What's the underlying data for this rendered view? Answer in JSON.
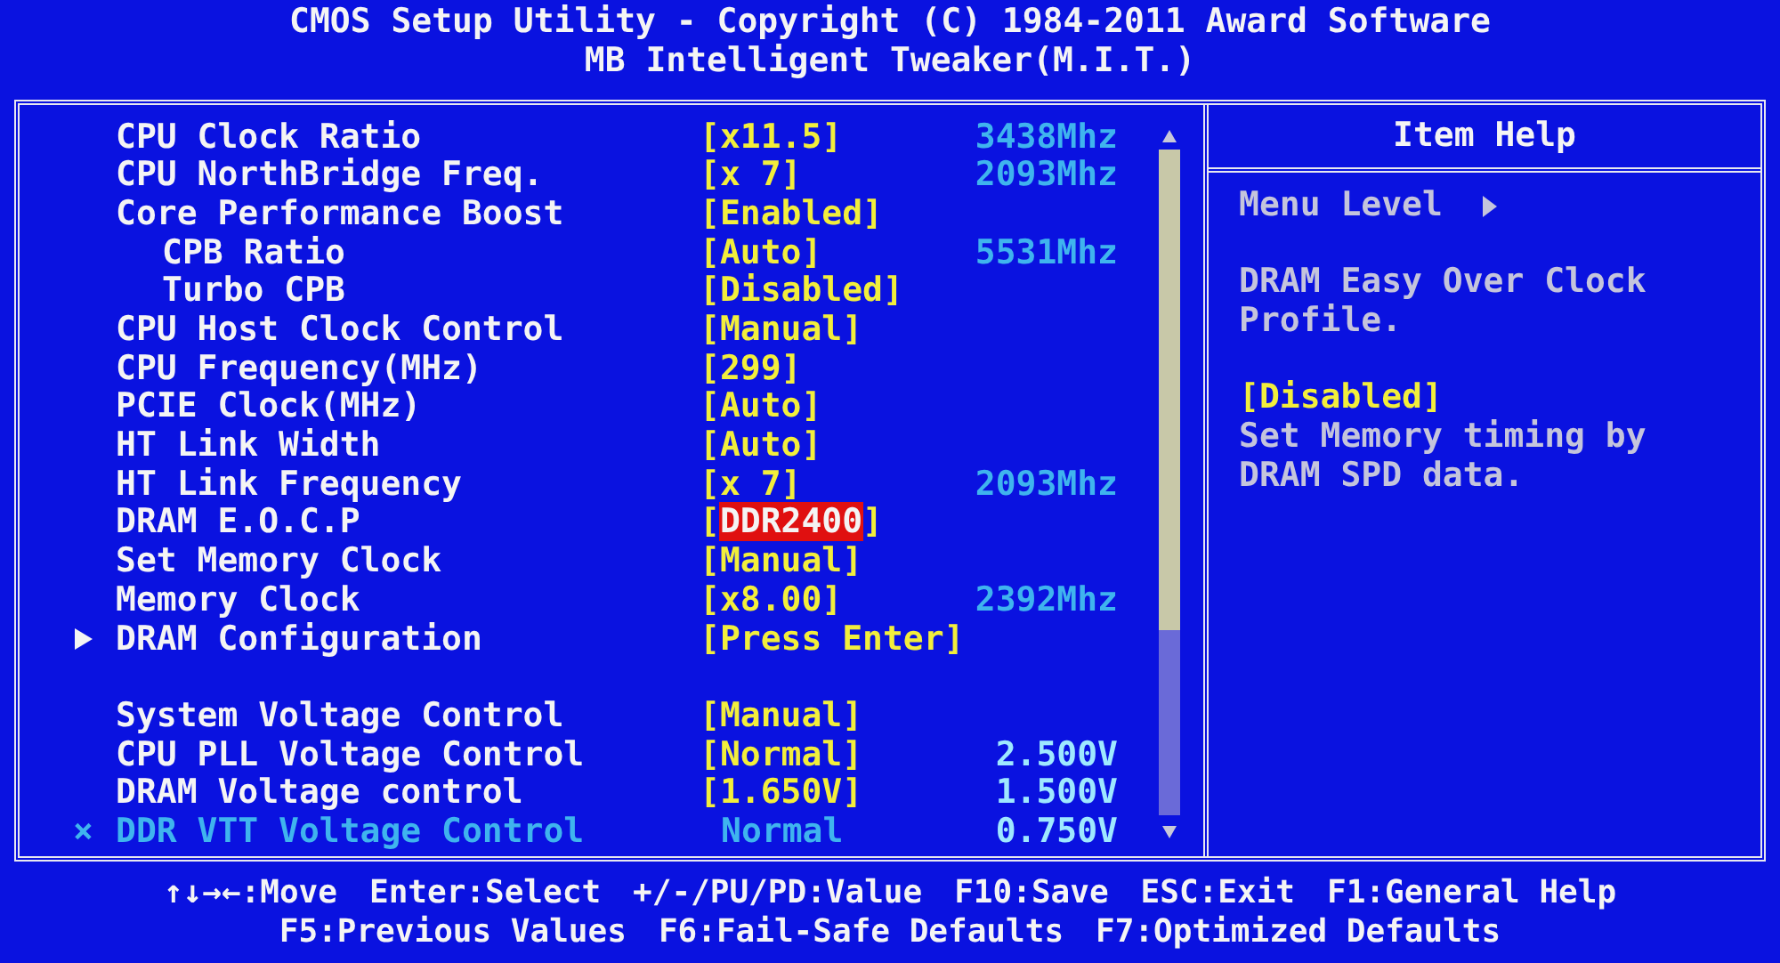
{
  "header": {
    "title": "CMOS Setup Utility - Copyright (C) 1984-2011 Award Software",
    "subtitle": "MB Intelligent Tweaker(M.I.T.)"
  },
  "settings": [
    {
      "kind": "setting",
      "label": "CPU Clock Ratio",
      "value": "[x11.5]",
      "reading": "3438Mhz",
      "selected": false,
      "disabled": false
    },
    {
      "kind": "setting",
      "label": "CPU NorthBridge Freq.",
      "value": "[x 7]",
      "reading": "2093Mhz",
      "selected": false,
      "disabled": false
    },
    {
      "kind": "setting",
      "label": "Core Performance Boost",
      "value": "[Enabled]",
      "selected": false,
      "disabled": false,
      "children": [
        {
          "kind": "setting",
          "label": "CPB Ratio",
          "value": "[Auto]",
          "reading": "5531Mhz",
          "selected": false,
          "disabled": false
        },
        {
          "kind": "setting",
          "label": "Turbo CPB",
          "value": "[Disabled]",
          "selected": false,
          "disabled": false
        }
      ]
    },
    {
      "kind": "setting",
      "label": "CPU Host Clock Control",
      "value": "[Manual]",
      "selected": false,
      "disabled": false
    },
    {
      "kind": "setting",
      "label": "CPU Frequency(MHz)",
      "value": "[299]",
      "selected": false,
      "disabled": false
    },
    {
      "kind": "setting",
      "label": "PCIE Clock(MHz)",
      "value": "[Auto]",
      "selected": false,
      "disabled": false
    },
    {
      "kind": "setting",
      "label": "HT Link Width",
      "value": "[Auto]",
      "selected": false,
      "disabled": false
    },
    {
      "kind": "setting",
      "label": "HT Link Frequency",
      "value": "[x 7]",
      "reading": "2093Mhz",
      "selected": false,
      "disabled": false
    },
    {
      "kind": "setting",
      "label": "DRAM E.O.C.P",
      "value": "[DDR2400]",
      "selected": true,
      "disabled": false
    },
    {
      "kind": "setting",
      "label": "Set Memory Clock",
      "value": "[Manual]",
      "selected": false,
      "disabled": false
    },
    {
      "kind": "setting",
      "label": "Memory Clock",
      "value": "[x8.00]",
      "reading": "2392Mhz",
      "selected": false,
      "disabled": false
    },
    {
      "kind": "submenu",
      "label": "DRAM Configuration",
      "value": "[Press Enter]",
      "selected": false,
      "disabled": false
    },
    {
      "kind": "spacer"
    },
    {
      "kind": "setting",
      "label": "System Voltage Control",
      "value": "[Manual]",
      "selected": false,
      "disabled": false
    },
    {
      "kind": "setting",
      "label": "CPU PLL Voltage Control",
      "value": "[Normal]",
      "reading": "2.500V",
      "selected": false,
      "disabled": false
    },
    {
      "kind": "setting",
      "label": "DRAM Voltage control",
      "value": "[1.650V]",
      "reading": "1.500V",
      "selected": false,
      "disabled": false
    },
    {
      "kind": "setting",
      "label": "DDR VTT Voltage Control",
      "value": "Normal",
      "reading": "0.750V",
      "selected": false,
      "disabled": true,
      "mark": "×"
    }
  ],
  "help": {
    "title": "Item Help",
    "menu_level": "Menu Level",
    "paragraphs": [
      {
        "kind": "text",
        "text": "DRAM Easy Over Clock Profile."
      },
      {
        "kind": "option",
        "text": "[Disabled]"
      },
      {
        "kind": "text",
        "text": "Set Memory timing by DRAM SPD data."
      }
    ]
  },
  "footer": [
    [
      "↑↓→←:Move",
      "Enter:Select",
      "+/-/PU/PD:Value",
      "F10:Save",
      "ESC:Exit",
      "F1:General Help"
    ],
    [
      "F5:Previous Values",
      "F6:Fail-Safe Defaults",
      "F7:Optimized Defaults"
    ]
  ]
}
